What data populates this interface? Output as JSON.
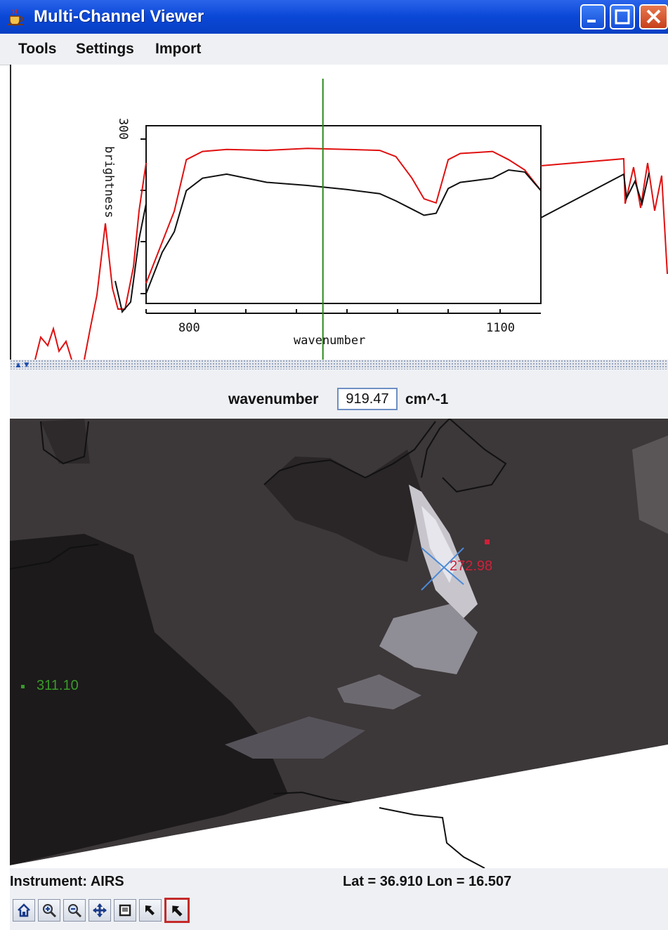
{
  "window": {
    "title": "Multi-Channel Viewer",
    "icon": "java-cup-icon"
  },
  "menubar": {
    "items": [
      "Tools",
      "Settings",
      "Import"
    ]
  },
  "spectrum_chart": {
    "xlabel": "wavenumber",
    "ylabel": "brightness",
    "xticks": [
      "800",
      "1100"
    ],
    "yticks": [
      "300"
    ]
  },
  "chart_data": {
    "type": "line",
    "xlabel": "wavenumber",
    "ylabel": "brightness",
    "xticks": [
      "800",
      "1100"
    ],
    "yticks": [
      "300"
    ],
    "selected_wavenumber": 919.47,
    "series": [
      {
        "color": "#e01010",
        "x": [
          700,
          720,
          735,
          750,
          770,
          800,
          850,
          900,
          950,
          990,
          1010,
          1030,
          1045,
          1060,
          1075,
          1090,
          1110,
          1130,
          1150,
          1170,
          1190
        ],
        "y": [
          160,
          200,
          230,
          280,
          288,
          290,
          289,
          291,
          290,
          289,
          283,
          262,
          242,
          238,
          280,
          286,
          287,
          288,
          280,
          270,
          250
        ]
      },
      {
        "color": "#111111",
        "x": [
          700,
          720,
          735,
          750,
          770,
          800,
          850,
          900,
          950,
          990,
          1010,
          1030,
          1045,
          1060,
          1075,
          1090,
          1110,
          1130,
          1150,
          1170,
          1190
        ],
        "y": [
          150,
          190,
          210,
          250,
          262,
          266,
          258,
          255,
          251,
          247,
          240,
          232,
          226,
          228,
          252,
          258,
          260,
          262,
          270,
          268,
          250
        ]
      }
    ]
  },
  "wavenumber": {
    "label": "wavenumber",
    "value": "919.47",
    "unit": "cm^-1"
  },
  "map": {
    "probe_red_value": "272.98",
    "probe_green_value": "311.10",
    "colors": {
      "probe_red": "#d0203a",
      "probe_green": "#3a9a2a",
      "crosshair": "#4a8ad8"
    }
  },
  "status": {
    "instrument": "Instrument: AIRS",
    "latlon": "Lat = 36.910  Lon = 16.507"
  },
  "toolbar": {
    "tools": [
      "home-icon",
      "zoom-in-icon",
      "zoom-out-icon",
      "pan-icon",
      "box-select-icon",
      "pointer-icon",
      "pointer-selected-icon"
    ]
  }
}
